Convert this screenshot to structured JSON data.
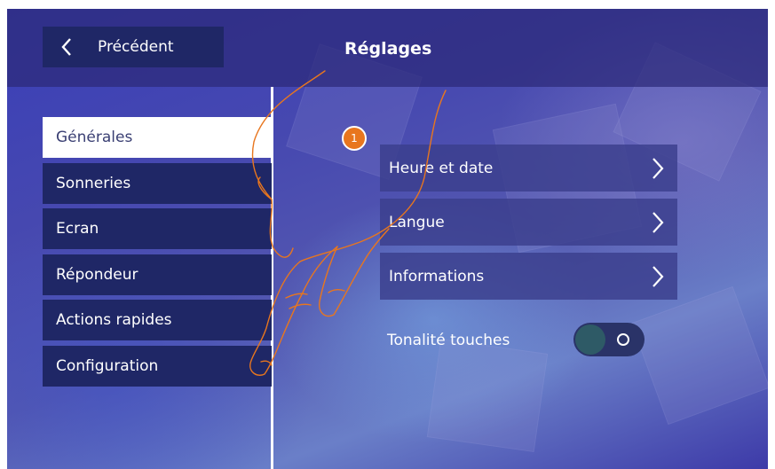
{
  "header": {
    "back_label": "Précédent",
    "title": "Réglages"
  },
  "sidebar": {
    "items": [
      {
        "label": "Générales",
        "selected": true
      },
      {
        "label": "Sonneries",
        "selected": false
      },
      {
        "label": "Ecran",
        "selected": false
      },
      {
        "label": "Répondeur",
        "selected": false
      },
      {
        "label": "Actions rapides",
        "selected": false
      },
      {
        "label": "Configuration",
        "selected": false
      }
    ]
  },
  "main": {
    "rows": [
      {
        "label": "Heure et date"
      },
      {
        "label": "Langue"
      },
      {
        "label": "Informations"
      }
    ],
    "toggle": {
      "label": "Tonalité touches",
      "state": "off"
    }
  },
  "annotation": {
    "step_badge": "1"
  },
  "icons": {
    "back": "chevron-left-icon",
    "row_arrow": "chevron-right-icon",
    "toggle_ring": "circle-outline-icon"
  },
  "colors": {
    "menu_bg": "#1f2766",
    "selected_bg": "#ffffff",
    "selected_text": "#3a3f73",
    "row_bg": "#3a3e8c",
    "badge": "#e8761e",
    "hand_outline": "#e8761e"
  }
}
